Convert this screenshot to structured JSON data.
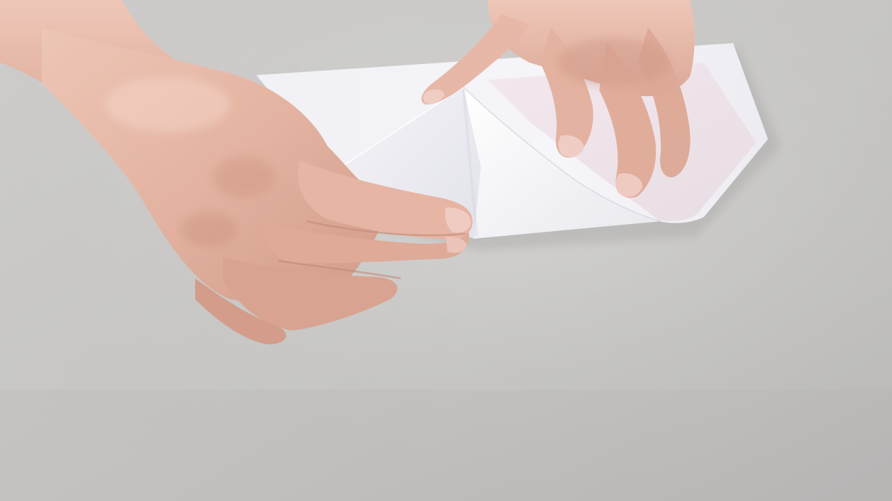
{
  "scene": {
    "subject": "paper-folding",
    "colors": {
      "table": "#c9c8c6",
      "table_light": "#d6d5d3",
      "table_dark": "#b9b8b6",
      "paper": "#f3f3f7",
      "paper_shadow": "#dcdce6",
      "paper_flap": "#eeeef4",
      "paper_pink": "#f0e4ea",
      "skin": "#e6b8a6",
      "skin_shadow": "#cf9a89",
      "skin_light": "#f1cfc2",
      "nail": "#efc9c0"
    }
  }
}
